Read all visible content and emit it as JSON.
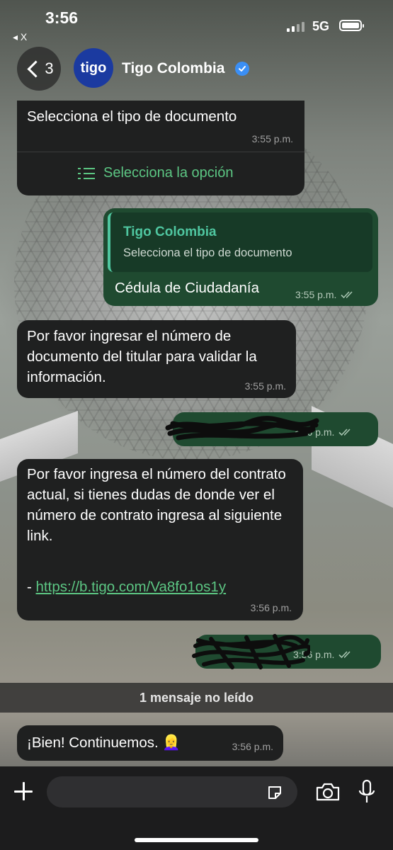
{
  "status_bar": {
    "time": "3:56",
    "back_app": "◂ X",
    "network": "5G"
  },
  "header": {
    "back_count": "3",
    "avatar_text": "tigo",
    "contact_name": "Tigo Colombia"
  },
  "messages": [
    {
      "direction": "incoming",
      "text": "Selecciona el tipo de documento",
      "time": "3:55 p.m.",
      "option_label": "Selecciona la opción"
    },
    {
      "direction": "outgoing",
      "quote_author": "Tigo Colombia",
      "quote_text": "Selecciona el tipo de documento",
      "text": "Cédula de Ciudadanía",
      "time": "3:55 p.m."
    },
    {
      "direction": "incoming",
      "text": "Por favor ingresar el número de documento del titular para validar la información.",
      "time": "3:55 p.m."
    },
    {
      "direction": "outgoing",
      "text": "",
      "time": "3:56 p.m."
    },
    {
      "direction": "incoming",
      "text": "Por favor ingresa el número del contrato actual, si tienes dudas de donde ver el número de contrato ingresa al siguiente link.",
      "link_prefix": "- ",
      "link": "https://b.tigo.com/Va8fo1os1y",
      "time": "3:56 p.m."
    },
    {
      "direction": "outgoing",
      "text": "",
      "time": "3:56 p.m."
    },
    {
      "direction": "incoming",
      "text": "¡Bien! Continuemos. 👱‍♀️",
      "time": "3:56 p.m."
    }
  ],
  "unread_banner": "1 mensaje no leído",
  "composer": {
    "placeholder": "",
    "icons": [
      "plus-icon",
      "sticker-icon",
      "camera-icon",
      "microphone-icon"
    ]
  },
  "colors": {
    "incoming_bubble": "#1f2020",
    "outgoing_bubble": "#1f4a30",
    "accent_green": "#5cc683",
    "verified_blue": "#3b8ff5",
    "avatar_blue": "#1b3aa0"
  }
}
